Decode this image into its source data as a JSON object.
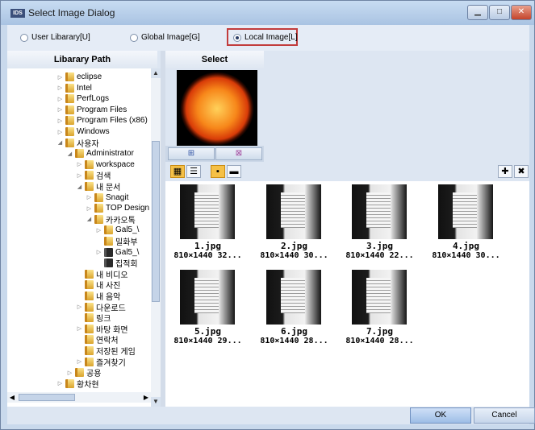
{
  "window": {
    "app_icon_text": "IDS",
    "title": "Select Image Dialog",
    "controls": [
      "minimize",
      "maximize",
      "close"
    ]
  },
  "source_options": [
    {
      "label": "User Libarary[U]",
      "selected": false
    },
    {
      "label": "Global Image[G]",
      "selected": false
    },
    {
      "label": "Local Image[L]",
      "selected": true
    }
  ],
  "left_panel": {
    "header": "Libarary Path",
    "tree": [
      {
        "label": "eclipse",
        "depth": 0,
        "toggle": "▷",
        "kind": "folder"
      },
      {
        "label": "Intel",
        "depth": 0,
        "toggle": "▷",
        "kind": "folder"
      },
      {
        "label": "PerfLogs",
        "depth": 0,
        "toggle": "▷",
        "kind": "folder"
      },
      {
        "label": "Program Files",
        "depth": 0,
        "toggle": "▷",
        "kind": "folder"
      },
      {
        "label": "Program Files (x86)",
        "depth": 0,
        "toggle": "▷",
        "kind": "folder"
      },
      {
        "label": "Windows",
        "depth": 0,
        "toggle": "▷",
        "kind": "folder"
      },
      {
        "label": "사용자",
        "depth": 0,
        "toggle": "◢",
        "kind": "folder"
      },
      {
        "label": "Administrator",
        "depth": 1,
        "toggle": "◢",
        "kind": "folder"
      },
      {
        "label": "workspace",
        "depth": 2,
        "toggle": "▷",
        "kind": "folder"
      },
      {
        "label": "검색",
        "depth": 2,
        "toggle": "▷",
        "kind": "folder"
      },
      {
        "label": "내 문서",
        "depth": 2,
        "toggle": "◢",
        "kind": "folder"
      },
      {
        "label": "Snagit",
        "depth": 3,
        "toggle": "▷",
        "kind": "folder"
      },
      {
        "label": "TOP Design",
        "depth": 3,
        "toggle": "▷",
        "kind": "folder"
      },
      {
        "label": "카카오톡",
        "depth": 3,
        "toggle": "◢",
        "kind": "folder"
      },
      {
        "label": "Gal5_\\",
        "depth": 4,
        "toggle": "▷",
        "kind": "folder"
      },
      {
        "label": "밀화부",
        "depth": 4,
        "toggle": "",
        "kind": "folder"
      },
      {
        "label": "Gal5_\\",
        "depth": 4,
        "toggle": "▷",
        "kind": "zip"
      },
      {
        "label": "집적회",
        "depth": 4,
        "toggle": "",
        "kind": "zip"
      },
      {
        "label": "내 비디오",
        "depth": 2,
        "toggle": "",
        "kind": "folder"
      },
      {
        "label": "내 사진",
        "depth": 2,
        "toggle": "",
        "kind": "folder"
      },
      {
        "label": "내 음악",
        "depth": 2,
        "toggle": "",
        "kind": "folder"
      },
      {
        "label": "다운로드",
        "depth": 2,
        "toggle": "▷",
        "kind": "folder"
      },
      {
        "label": "링크",
        "depth": 2,
        "toggle": "",
        "kind": "folder"
      },
      {
        "label": "바탕 화면",
        "depth": 2,
        "toggle": "▷",
        "kind": "folder"
      },
      {
        "label": "연락처",
        "depth": 2,
        "toggle": "",
        "kind": "folder"
      },
      {
        "label": "저장된 게임",
        "depth": 2,
        "toggle": "",
        "kind": "folder"
      },
      {
        "label": "즐겨찾기",
        "depth": 2,
        "toggle": "▷",
        "kind": "folder"
      },
      {
        "label": "공용",
        "depth": 1,
        "toggle": "▷",
        "kind": "folder"
      },
      {
        "label": "황차현",
        "depth": 0,
        "toggle": "▷",
        "kind": "folder"
      }
    ]
  },
  "select_panel": {
    "header": "Select",
    "add_icon": "add-icon",
    "remove_icon": "remove-icon"
  },
  "images": [
    {
      "name": "1.jpg",
      "meta": "810×1440 32..."
    },
    {
      "name": "2.jpg",
      "meta": "810×1440 30..."
    },
    {
      "name": "3.jpg",
      "meta": "810×1440 22..."
    },
    {
      "name": "4.jpg",
      "meta": "810×1440 30..."
    },
    {
      "name": "5.jpg",
      "meta": "810×1440 29..."
    },
    {
      "name": "6.jpg",
      "meta": "810×1440 28..."
    },
    {
      "name": "7.jpg",
      "meta": "810×1440 28..."
    }
  ],
  "buttons": {
    "ok": "OK",
    "cancel": "Cancel"
  },
  "colors": {
    "highlight": "#c23c3c",
    "selected_tool": "#f5c046"
  }
}
